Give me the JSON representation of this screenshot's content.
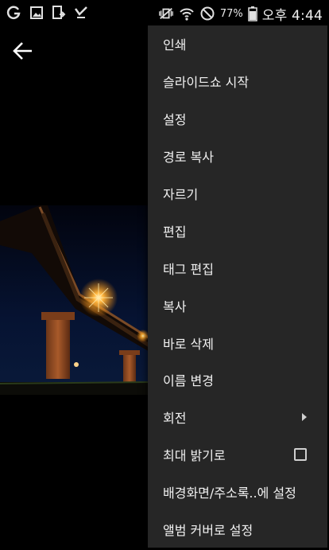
{
  "status_bar": {
    "battery": "77%",
    "time": "오후 4:44",
    "left_icons": [
      "g-icon",
      "gallery-icon",
      "upload-icon",
      "check-icon"
    ],
    "right_icons": [
      "vibrate-mute-icon",
      "wifi-icon",
      "dnd-icon",
      "battery-icon"
    ]
  },
  "toolbar": {
    "back_icon": "arrow-left-icon"
  },
  "menu": {
    "items": [
      {
        "label": "인쇄"
      },
      {
        "label": "슬라이드쇼 시작"
      },
      {
        "label": "설정"
      },
      {
        "label": "경로 복사"
      },
      {
        "label": "자르기"
      },
      {
        "label": "편집"
      },
      {
        "label": "태그 편집"
      },
      {
        "label": "복사"
      },
      {
        "label": "바로 삭제"
      },
      {
        "label": "이름 변경"
      },
      {
        "label": "회전",
        "submenu": true
      },
      {
        "label": "최대 밝기로",
        "checkbox": true,
        "checked": false
      },
      {
        "label": "배경화면/주소록..에 설정"
      },
      {
        "label": "앨범 커버로 설정"
      }
    ]
  },
  "colors": {
    "menu_bg": "#262626",
    "menu_text": "#f1f1f1",
    "background": "#000000"
  }
}
